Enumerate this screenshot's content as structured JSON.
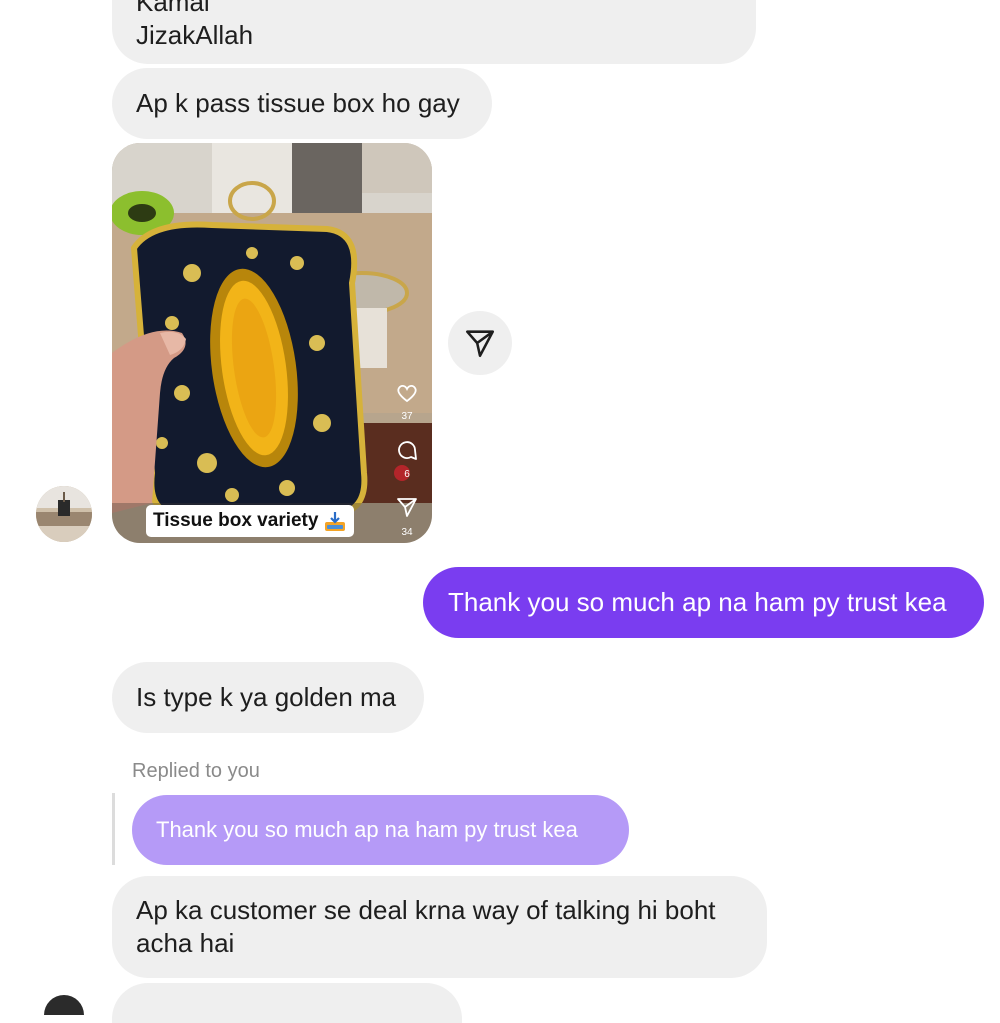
{
  "messages": {
    "m1_line1": "Kamal",
    "m1_line2": "JizakAllah",
    "m2": "Ap k pass tissue box ho gay",
    "m3_mine": "Thank you so much ap na ham py trust kea",
    "m4": "Is type k ya golden ma",
    "m5_line1": "Ap ka customer se deal krna way of talking hi boht",
    "m5_line2": "acha hai"
  },
  "reel": {
    "caption": "Tissue box  variety",
    "likes": "37",
    "comments": "6",
    "shares": "34",
    "download_icon": "download-tray-icon"
  },
  "reply": {
    "label": "Replied to you",
    "quoted": "Thank you so much ap na ham py trust kea"
  },
  "colors": {
    "incoming_bubble": "#efefef",
    "outgoing_bubble": "#7a3df0",
    "quoted_bubble": "#b59af7",
    "background": "#ffffff"
  },
  "icons": [
    "send-icon",
    "heart-icon",
    "comment-icon",
    "share-icon",
    "avatar"
  ]
}
